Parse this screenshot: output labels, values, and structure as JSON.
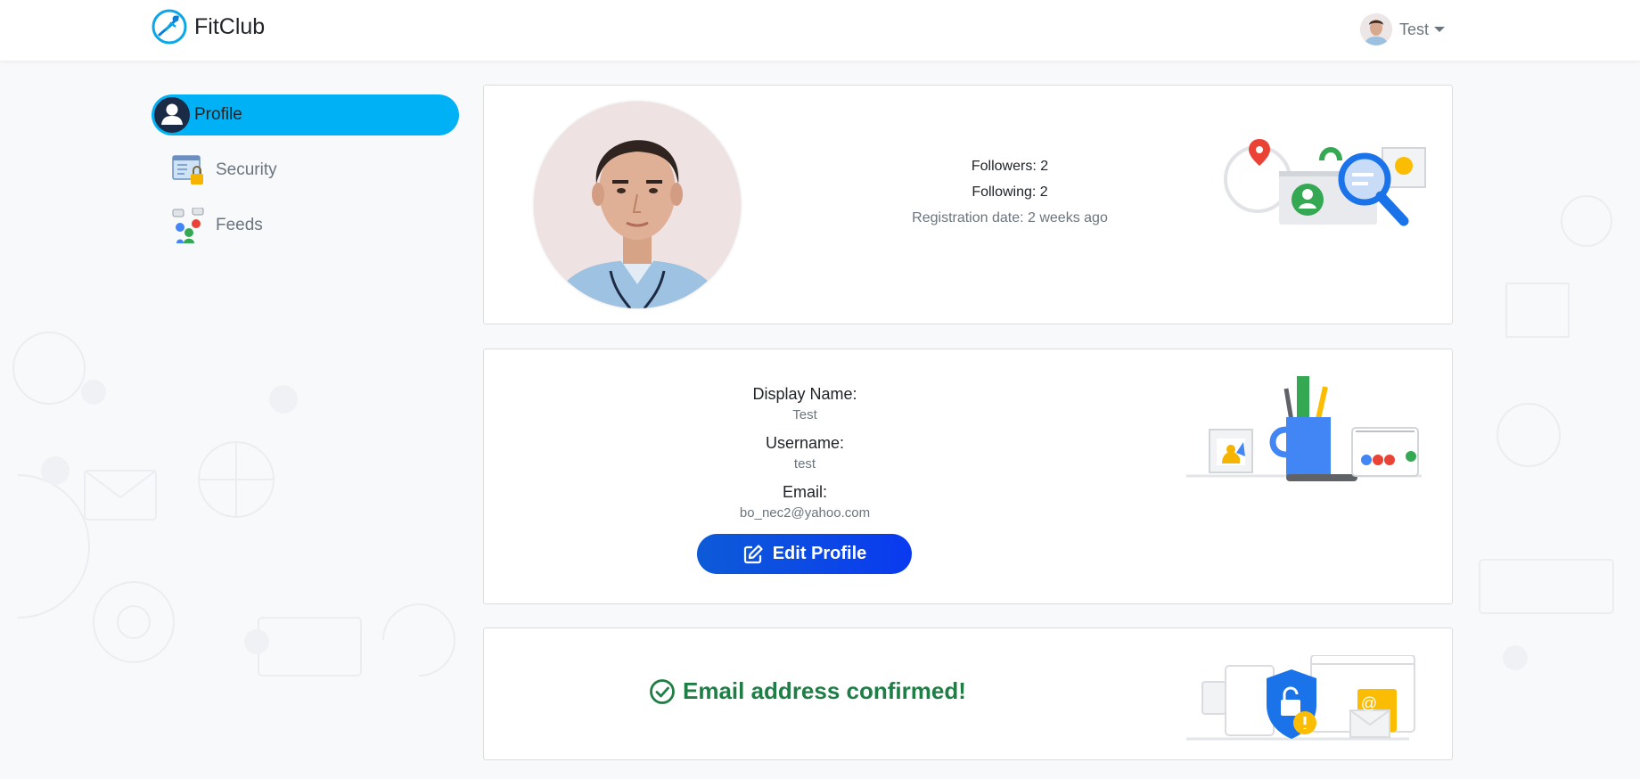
{
  "navbar": {
    "brand": "FitClub",
    "user_name": "Test"
  },
  "sidebar": {
    "items": [
      {
        "label": "Profile",
        "icon": "profile-icon",
        "active": true
      },
      {
        "label": "Security",
        "icon": "security-icon",
        "active": false
      },
      {
        "label": "Feeds",
        "icon": "feeds-icon",
        "active": false
      }
    ]
  },
  "profile_card": {
    "followers": "Followers: 2",
    "following": "Following: 2",
    "registration": "Registration date: 2 weeks ago"
  },
  "details_card": {
    "display_name_label": "Display Name:",
    "display_name_value": "Test",
    "username_label": "Username:",
    "username_value": "test",
    "email_label": "Email:",
    "email_value": "bo_nec2@yahoo.com",
    "edit_button": "Edit Profile"
  },
  "email_card": {
    "message": "Email address confirmed!"
  },
  "colors": {
    "accent": "#00b2f5",
    "button": "#0a46e6",
    "success": "#1e7e45"
  }
}
